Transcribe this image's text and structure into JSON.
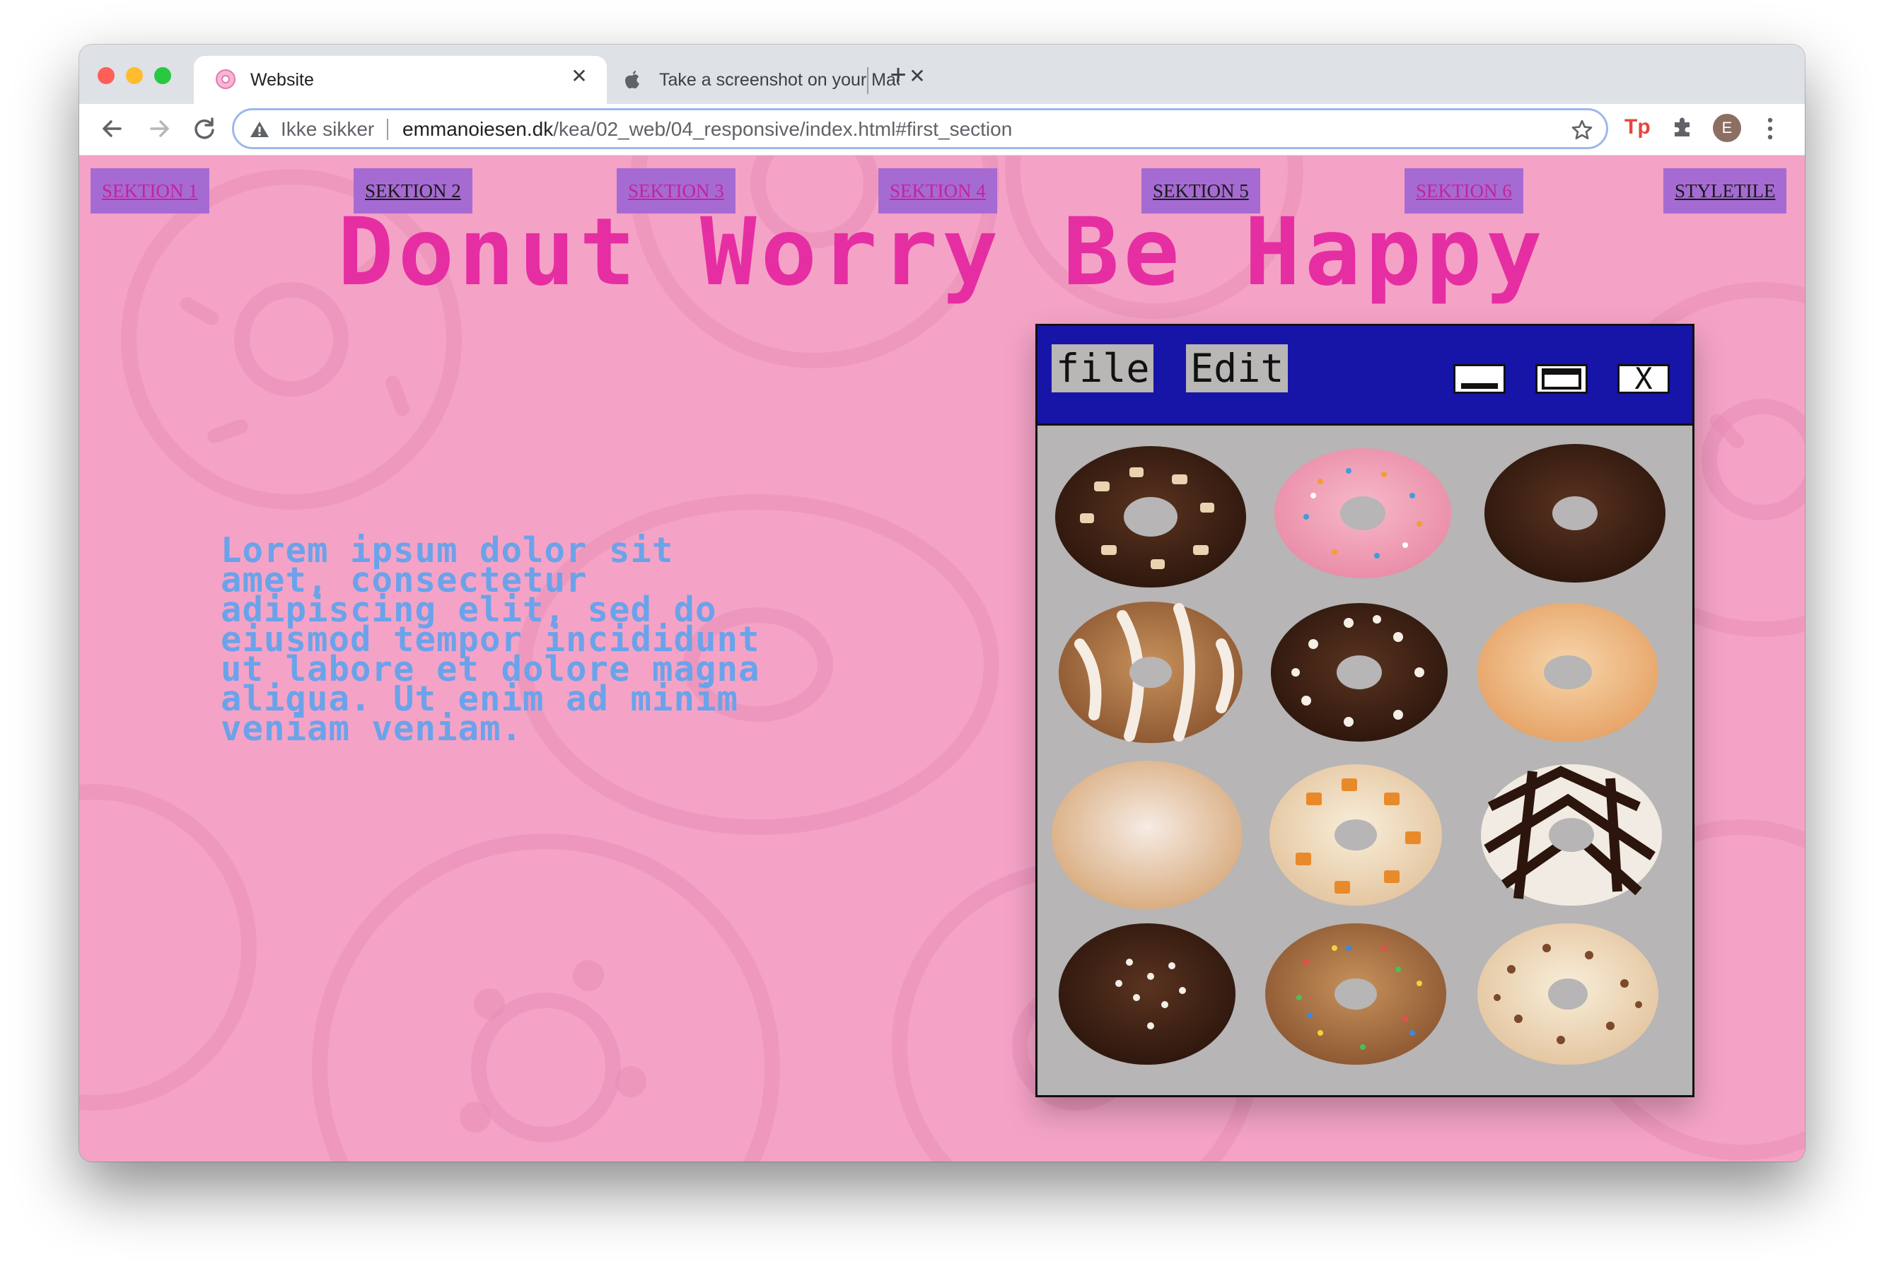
{
  "browser": {
    "tabs": [
      {
        "title": "Website",
        "active": true
      },
      {
        "title": "Take a screenshot on your Mac",
        "active": false
      }
    ],
    "new_tab_label": "+",
    "close_glyph": "✕",
    "address_bar": {
      "security_label": "Ikke sikker",
      "url_host": "emmanoiesen.dk",
      "url_path": "/kea/02_web/04_responsive/index.html#first_section"
    },
    "extension_label": "Tp",
    "profile_initial": "E"
  },
  "page": {
    "nav": [
      {
        "label": "SEKTION 1",
        "visited": true
      },
      {
        "label": "SEKTION 2",
        "visited": false
      },
      {
        "label": "SEKTION 3",
        "visited": true
      },
      {
        "label": "SEKTION 4",
        "visited": true
      },
      {
        "label": "SEKTION 5",
        "visited": false
      },
      {
        "label": "SEKTION 6",
        "visited": true
      },
      {
        "label": "STYLETILE",
        "visited": false
      }
    ],
    "title": "Donut Worry Be Happy",
    "body_text": "Lorem ipsum dolor sit amet, consectetur adipiscing elit, sed do eiusmod tempor incididunt ut labore et dolore magna aliqua. Ut enim ad minim veniam veniam.",
    "retro_window": {
      "menu": [
        "file",
        "Edit"
      ],
      "close_label": "X"
    },
    "colors": {
      "page_background": "#f4a3c6",
      "nav_button": "#a66bd2",
      "title": "#e62ea3",
      "body_text": "#6aa3ea",
      "window_titlebar": "#1715a8",
      "window_body": "#b7b5b5"
    }
  }
}
